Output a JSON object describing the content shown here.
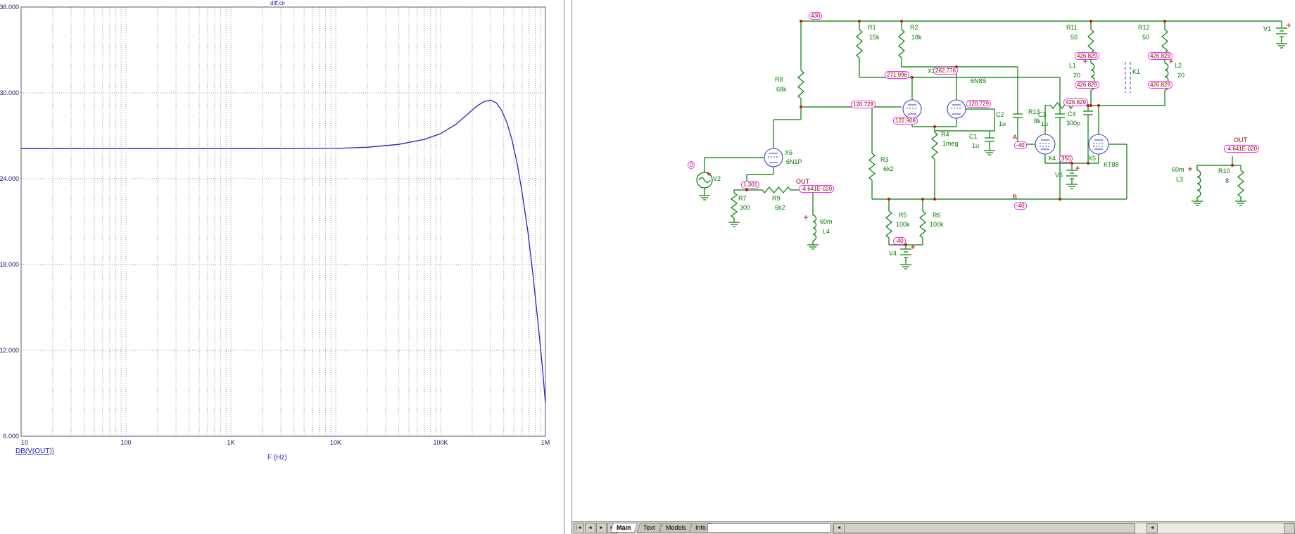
{
  "window": {
    "left_title": "diff.cir"
  },
  "colors": {
    "wire": "#007c00",
    "device": "#4343c8",
    "junction": "#cc1111",
    "badge_border": "#ff22ff",
    "badge_text": "#8b0000",
    "label": "#007c00",
    "node_label": "#8b0000",
    "trace": "#2222cc",
    "grid": "#9a9aa6"
  },
  "chart_data": {
    "type": "line",
    "title": "diff.cir",
    "xlabel": "F (Hz)",
    "ylabel": "",
    "x_scale": "log",
    "xlim": [
      10,
      1000000
    ],
    "ylim": [
      6,
      36
    ],
    "grid": "dotted",
    "legend_position": "bottom-left",
    "y_ticks": [
      36,
      30,
      24,
      18,
      12,
      6
    ],
    "y_tick_labels": [
      "36.000",
      "30.000",
      "24.000",
      "18.000",
      "12.000",
      "6.000"
    ],
    "x_ticks": [
      10,
      100,
      1000,
      10000,
      100000,
      1000000
    ],
    "x_tick_labels": [
      "10",
      "100",
      "1K",
      "10K",
      "100K",
      "1M"
    ],
    "series": [
      {
        "name": "DB(V(OUT))",
        "color": "#2222cc",
        "points": [
          [
            10,
            26.1
          ],
          [
            100,
            26.1
          ],
          [
            1000,
            26.1
          ],
          [
            3000,
            26.1
          ],
          [
            10000,
            26.12
          ],
          [
            20000,
            26.2
          ],
          [
            40000,
            26.4
          ],
          [
            70000,
            26.75
          ],
          [
            100000,
            27.15
          ],
          [
            140000,
            27.8
          ],
          [
            180000,
            28.5
          ],
          [
            220000,
            29.05
          ],
          [
            260000,
            29.4
          ],
          [
            300000,
            29.5
          ],
          [
            340000,
            29.3
          ],
          [
            380000,
            28.8
          ],
          [
            430000,
            27.9
          ],
          [
            480000,
            26.7
          ],
          [
            540000,
            25.0
          ],
          [
            600000,
            23.0
          ],
          [
            680000,
            20.3
          ],
          [
            760000,
            17.3
          ],
          [
            850000,
            13.9
          ],
          [
            930000,
            11.0
          ],
          [
            1000000,
            8.3
          ]
        ]
      }
    ]
  },
  "schematic": {
    "labels": {
      "r1": "R1",
      "r1v": "15k",
      "r2": "R2",
      "r2v": "18k",
      "r3": "R3",
      "r3v": "6k2",
      "r4": "R4",
      "r4v": "1meg",
      "r5": "R5",
      "r5v": "100k",
      "r6": "R6",
      "r6v": "100k",
      "r7": "R7",
      "r7v": "300",
      "r8": "R8",
      "r8v": "68k",
      "r9": "R9",
      "r9v": "6k2",
      "r10": "R10",
      "r10v": "8",
      "r11": "R11",
      "r11v": "50",
      "r12": "R12",
      "r12v": "50",
      "r13": "R13",
      "r13v": "8k",
      "c1": "C1",
      "c1v": "1u",
      "c2": "C2",
      "c2v": "1u",
      "c3": "C3",
      "c3v": "1u",
      "c4": "C4",
      "c4v": "300p",
      "l1": "L1",
      "l1v": "20",
      "l2": "L2",
      "l2v": "20",
      "l3": "L3",
      "l3v": "60m",
      "l4": "L4",
      "l4v": "60m",
      "k1": "K1",
      "x3": "X3",
      "x4": "X4",
      "x5": "X5",
      "x6": "X6",
      "t6n8s": "6N8S",
      "t6n1p": "6N1P",
      "tkt88": "KT88",
      "v1": "V1",
      "v2": "V2",
      "v4": "V4",
      "v5": "V5",
      "node_a": "A",
      "node_b": "B",
      "out1": "OUT",
      "out2": "OUT"
    },
    "badges": {
      "b430": "430",
      "b271": "271.996",
      "b262": "262.776",
      "b120a": "120.728",
      "b120b": "120.729",
      "b122": "122.908",
      "b426a": "426.829",
      "b426b": "426.829",
      "b426c": "426.829",
      "b426d": "426.829",
      "b426e": "426.829",
      "b1301": "1.301",
      "b0": "0",
      "b350": "350",
      "bm40a": "-40",
      "bm40b": "-40",
      "bm40c": "-40",
      "bza": "-4.641E-020",
      "bzb": "-4.641E-020"
    }
  },
  "tabbar": {
    "nav": [
      "|◄",
      "◄",
      "►",
      "►|"
    ],
    "tabs": [
      "Main",
      "Text",
      "Models",
      "Info"
    ],
    "active": "Main",
    "scroll_left": "◄",
    "scroll_right": "►"
  }
}
